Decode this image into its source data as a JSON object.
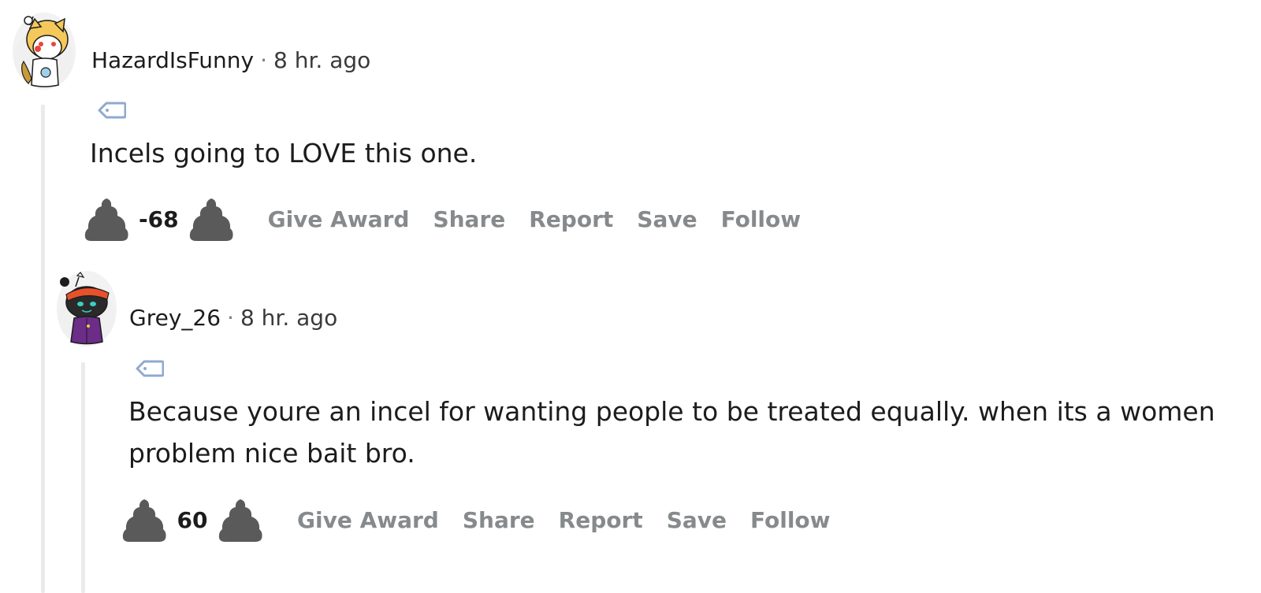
{
  "comments": [
    {
      "username": "HazardIsFunny",
      "separator": "·",
      "time": "8 hr. ago",
      "avatar_icon": "snoo-avatar-dog-costume-icon",
      "flair_icon": "tag-icon",
      "body": "Incels going to LOVE this one.",
      "score": "-68",
      "actions": {
        "give_award": "Give Award",
        "share": "Share",
        "report": "Report",
        "save": "Save",
        "follow": "Follow"
      }
    },
    {
      "username": "Grey_26",
      "separator": "·",
      "time": "8 hr. ago",
      "avatar_icon": "snoo-avatar-dark-orange-bandana-icon",
      "flair_icon": "tag-icon",
      "body": "Because youre an incel for wanting people to be treated equally. when its a women problem nice bait bro.",
      "score": "60",
      "actions": {
        "give_award": "Give Award",
        "share": "Share",
        "report": "Report",
        "save": "Save",
        "follow": "Follow"
      }
    }
  ],
  "colors": {
    "vote_icon": "#5a5a5a",
    "action_text": "#878a8c",
    "flair_tag": "#8fa9d0",
    "thread_line": "#eaeaea"
  }
}
